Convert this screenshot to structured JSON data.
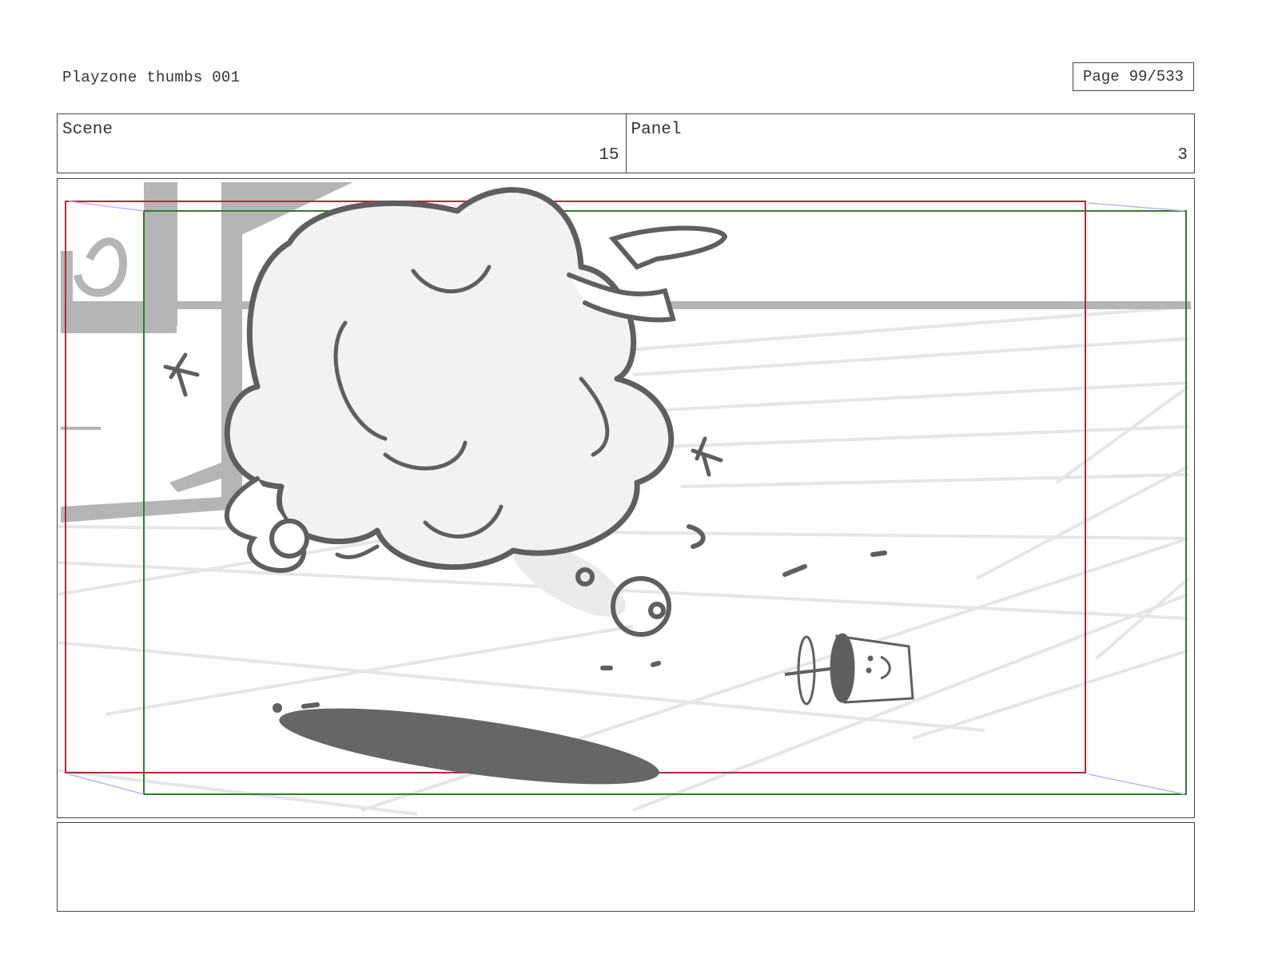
{
  "header": {
    "title": "Playzone thumbs 001",
    "page_label": "Page",
    "page_value": "99/533"
  },
  "info": {
    "scene_label": "Scene",
    "scene_value": "15",
    "panel_label": "Panel",
    "panel_value": "3"
  },
  "notes": {
    "text": ""
  },
  "colors": {
    "safe_frame": "#b0283a",
    "action_frame": "#2e7d32",
    "sketch_line": "#5f5f5f",
    "shadow": "#666666",
    "background_grey": "#b5b5b5",
    "floor_grid": "#e6e6e6"
  },
  "icons": [
    "star-icon",
    "cup-icon",
    "smiley-face-icon"
  ]
}
